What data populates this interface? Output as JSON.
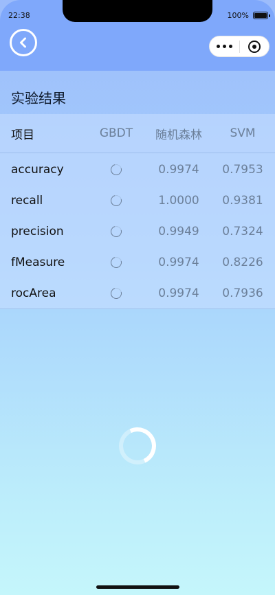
{
  "status_bar": {
    "time": "22:38",
    "battery": "100%"
  },
  "nav": {
    "back_icon": "back-arrow-icon",
    "more_icon": "more-dots-icon",
    "close_icon": "target-close-icon"
  },
  "section": {
    "title": "实验结果"
  },
  "table": {
    "headers": [
      "项目",
      "GBDT",
      "随机森林",
      "SVM"
    ],
    "rows": [
      {
        "metric": "accuracy",
        "gbdt": "",
        "rf": "0.9974",
        "svm": "0.7953"
      },
      {
        "metric": "recall",
        "gbdt": "",
        "rf": "1.0000",
        "svm": "0.9381"
      },
      {
        "metric": "precision",
        "gbdt": "",
        "rf": "0.9949",
        "svm": "0.7324"
      },
      {
        "metric": "fMeasure",
        "gbdt": "",
        "rf": "0.9974",
        "svm": "0.8226"
      },
      {
        "metric": "rocArea",
        "gbdt": "",
        "rf": "0.9974",
        "svm": "0.7936"
      }
    ]
  },
  "colors": {
    "nav_bg": "#7fa8fb",
    "muted_text": "#6b7f99"
  }
}
